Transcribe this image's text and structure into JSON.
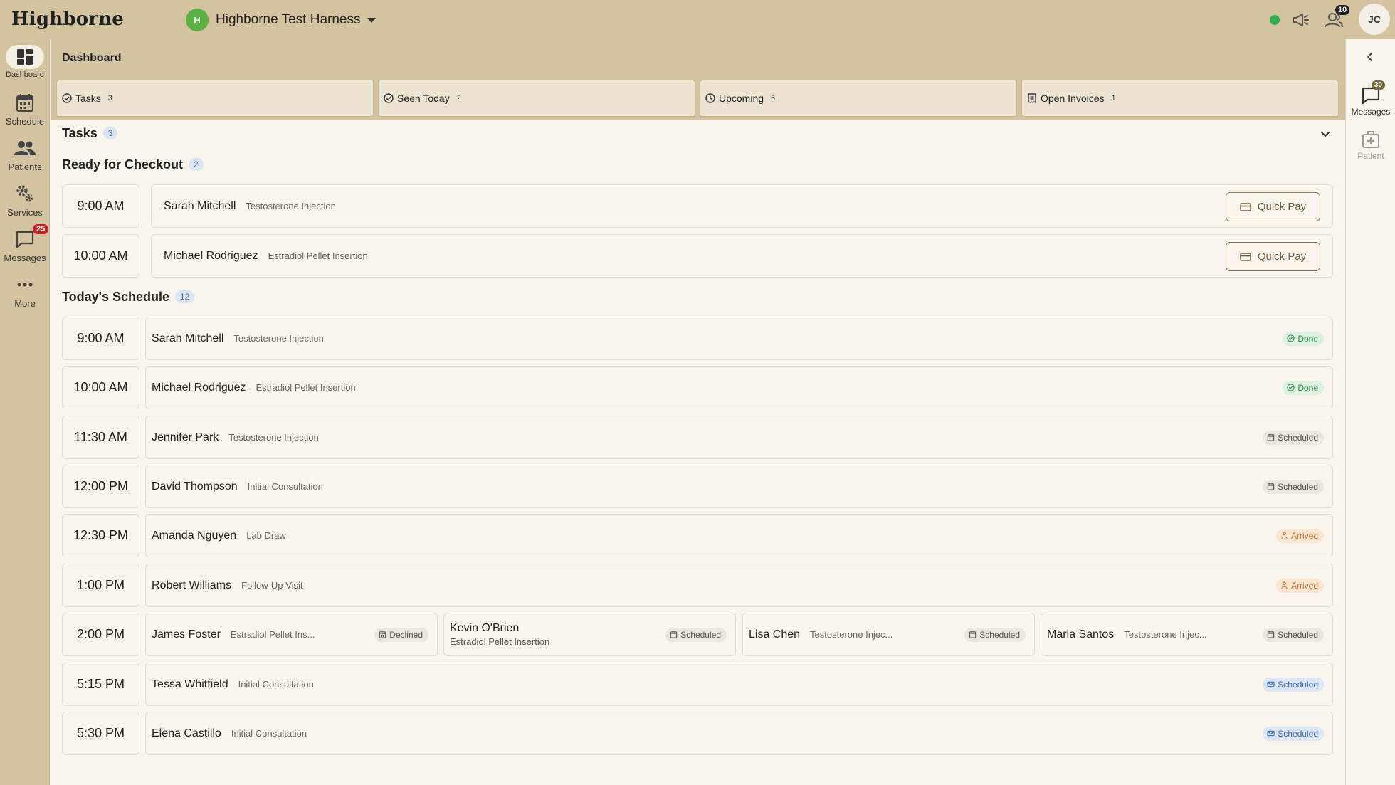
{
  "app": {
    "brand": "Highborne"
  },
  "org": {
    "initial": "H",
    "name": "Highborne Test Harness"
  },
  "topbar": {
    "notifications_badge": "10",
    "user_initials": "JC"
  },
  "nav": {
    "items": [
      {
        "label": "Dashboard",
        "icon": "dashboard-icon"
      },
      {
        "label": "Schedule",
        "icon": "calendar-icon"
      },
      {
        "label": "Patients",
        "icon": "people-icon"
      },
      {
        "label": "Services",
        "icon": "gears-icon"
      },
      {
        "label": "Messages",
        "icon": "message-icon",
        "badge": "25"
      },
      {
        "label": "More",
        "icon": "more-icon"
      }
    ]
  },
  "rail": {
    "messages": {
      "label": "Messages",
      "badge": "30"
    },
    "patient": {
      "label": "Patient"
    }
  },
  "page": {
    "title": "Dashboard"
  },
  "stats": [
    {
      "label": "Tasks",
      "count": "3",
      "icon": "check-circle-icon"
    },
    {
      "label": "Seen Today",
      "count": "2",
      "icon": "check-circle-icon"
    },
    {
      "label": "Upcoming",
      "count": "6",
      "icon": "clock-icon"
    },
    {
      "label": "Open Invoices",
      "count": "1",
      "icon": "receipt-icon"
    }
  ],
  "tasks": {
    "title": "Tasks",
    "count": "3"
  },
  "checkout": {
    "title": "Ready for Checkout",
    "count": "2",
    "button_label": "Quick Pay",
    "rows": [
      {
        "time": "9:00 AM",
        "name": "Sarah Mitchell",
        "service": "Testosterone Injection"
      },
      {
        "time": "10:00 AM",
        "name": "Michael Rodriguez",
        "service": "Estradiol Pellet Insertion"
      }
    ]
  },
  "schedule": {
    "title": "Today's Schedule",
    "count": "12",
    "rows": [
      {
        "time": "9:00 AM",
        "name": "Sarah Mitchell",
        "service": "Testosterone Injection",
        "status": "Done"
      },
      {
        "time": "10:00 AM",
        "name": "Michael Rodriguez",
        "service": "Estradiol Pellet Insertion",
        "status": "Done"
      },
      {
        "time": "11:30 AM",
        "name": "Jennifer Park",
        "service": "Testosterone Injection",
        "status": "Scheduled"
      },
      {
        "time": "12:00 PM",
        "name": "David Thompson",
        "service": "Initial Consultation",
        "status": "Scheduled"
      },
      {
        "time": "12:30 PM",
        "name": "Amanda Nguyen",
        "service": "Lab Draw",
        "status": "Arrived"
      },
      {
        "time": "1:00 PM",
        "name": "Robert Williams",
        "service": "Follow-Up Visit",
        "status": "Arrived"
      },
      {
        "time": "2:00 PM",
        "multi": [
          {
            "name": "James Foster",
            "service": "Estradiol Pellet Ins...",
            "status": "Declined"
          },
          {
            "name": "Kevin O'Brien",
            "service": "Estradiol Pellet Insertion",
            "status": "Scheduled"
          },
          {
            "name": "Lisa Chen",
            "service": "Testosterone Injec...",
            "status": "Scheduled"
          },
          {
            "name": "Maria Santos",
            "service": "Testosterone Injec...",
            "status": "Scheduled"
          }
        ]
      },
      {
        "time": "5:15 PM",
        "name": "Tessa Whitfield",
        "service": "Initial Consultation",
        "status": "Scheduled"
      },
      {
        "time": "5:30 PM",
        "name": "Elena Castillo",
        "service": "Initial Consultation",
        "status": "Scheduled"
      }
    ]
  },
  "colors": {
    "chrome": "#d4c3a0",
    "background": "#faf6ee",
    "done": "#2f8d45",
    "arrived": "#c2702c",
    "confirmed": "#3b6ab8",
    "badge_red": "#c81e1e"
  }
}
